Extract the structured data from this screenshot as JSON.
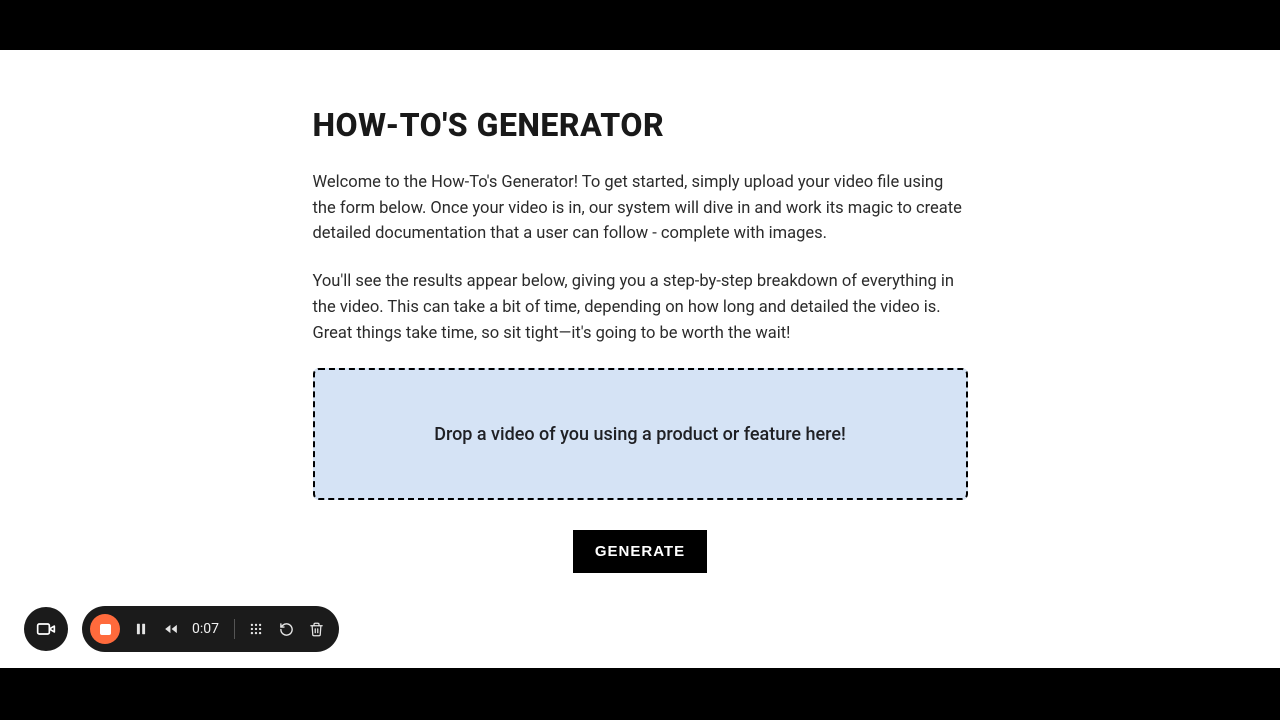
{
  "header": {
    "title": "HOW-TO'S GENERATOR"
  },
  "intro": {
    "p1": "Welcome to the How-To's Generator! To get started, simply upload your video file using the form below. Once your video is in, our system will dive in and work its magic to create detailed documentation that a user can follow - complete with images.",
    "p2": "You'll see the results appear below, giving you a step-by-step breakdown of everything in the video. This can take a bit of time, depending on how long and detailed the video is. Great things take time, so sit tight—it's going to be worth the wait!"
  },
  "dropzone": {
    "text": "Drop a video of you using a product or feature here!"
  },
  "actions": {
    "generate": "GENERATE"
  },
  "recorder": {
    "time": "0:07"
  }
}
